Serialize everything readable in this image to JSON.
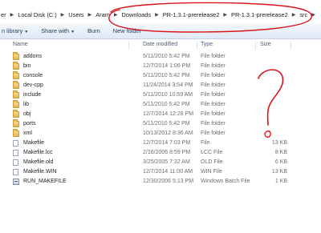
{
  "breadcrumb": {
    "items": [
      "er",
      "Local Disk (C:)",
      "Users",
      "Aram",
      "Downloads",
      "PR-1.3.1-prerelease2",
      "PR-1.3.1-prerelease2",
      "src"
    ]
  },
  "toolbar": {
    "library_label": "n library",
    "share_label": "Share with",
    "burn_label": "Burn",
    "new_folder_label": "New folder"
  },
  "columns": {
    "name": "Name",
    "date_modified": "Date modified",
    "type": "Type",
    "size": "Size"
  },
  "files": [
    {
      "name": "addons",
      "date": "5/11/2010 5:42 PM",
      "type": "File folder",
      "size": "",
      "icon": "folder-icon"
    },
    {
      "name": "bin",
      "date": "12/7/2014 1:06 PM",
      "type": "File folder",
      "size": "",
      "icon": "folder-icon"
    },
    {
      "name": "console",
      "date": "5/11/2010 5:42 PM",
      "type": "File folder",
      "size": "",
      "icon": "folder-icon"
    },
    {
      "name": "dev-cpp",
      "date": "11/24/2014 3:54 PM",
      "type": "File folder",
      "size": "",
      "icon": "folder-icon"
    },
    {
      "name": "include",
      "date": "5/11/2010 10:59 AM",
      "type": "File folder",
      "size": "",
      "icon": "folder-icon"
    },
    {
      "name": "lib",
      "date": "5/11/2010 5:42 PM",
      "type": "File folder",
      "size": "",
      "icon": "folder-icon"
    },
    {
      "name": "obj",
      "date": "12/7/2014 12:28 PM",
      "type": "File folder",
      "size": "",
      "icon": "folder-icon"
    },
    {
      "name": "ports",
      "date": "5/11/2010 5:42 PM",
      "type": "File folder",
      "size": "",
      "icon": "folder-icon"
    },
    {
      "name": "xml",
      "date": "10/13/2012 8:36 AM",
      "type": "File folder",
      "size": "",
      "icon": "folder-icon"
    },
    {
      "name": "Makefile",
      "date": "12/7/2014 7:03 PM",
      "type": "File",
      "size": "13 KB",
      "icon": "file-icon"
    },
    {
      "name": "Makefile.lcc",
      "date": "2/16/2006 8:59 PM",
      "type": "LCC File",
      "size": "8 KB",
      "icon": "file-icon"
    },
    {
      "name": "Makefile.old",
      "date": "3/25/2005 7:32 AM",
      "type": "OLD File",
      "size": "6 KB",
      "icon": "file-icon"
    },
    {
      "name": "Makefile.WIN",
      "date": "12/7/2014 11:00 AM",
      "type": "WIN File",
      "size": "13 KB",
      "icon": "file-icon"
    },
    {
      "name": "RUN_MAKEFILE",
      "date": "12/30/2006 5:13 PM",
      "type": "Windows Batch File",
      "size": "1 KB",
      "icon": "batch-file-icon"
    }
  ],
  "colors": {
    "annotation_red": "#d8141b",
    "toolbar_text": "#1e395b",
    "header_text": "#4c607a"
  }
}
